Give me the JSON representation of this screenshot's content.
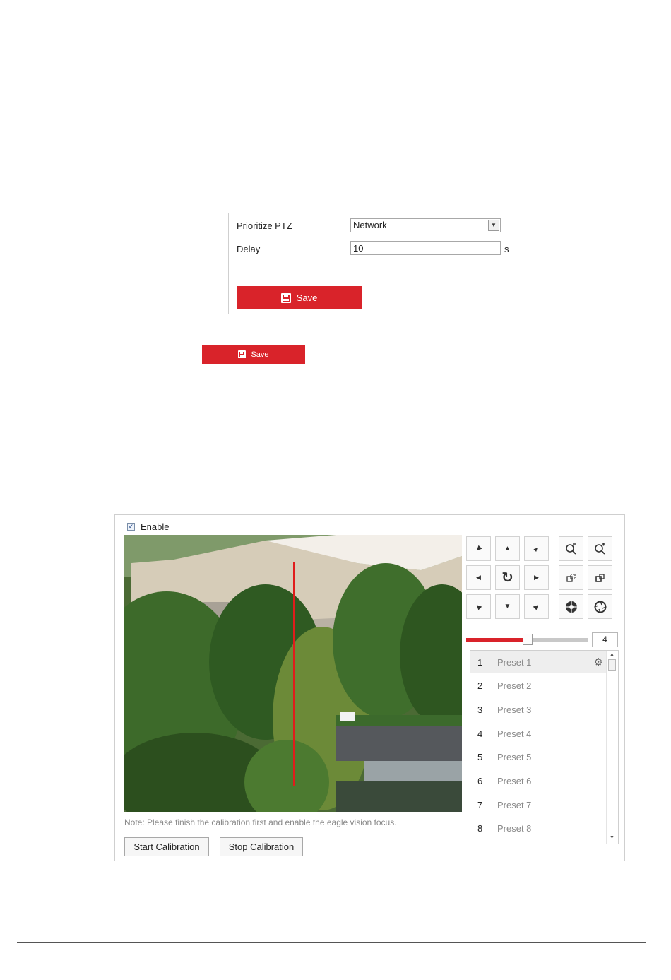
{
  "ptz_form": {
    "prioritize_label": "Prioritize PTZ",
    "prioritize_value": "Network",
    "delay_label": "Delay",
    "delay_value": "10",
    "delay_unit": "s",
    "save_label": "Save"
  },
  "standalone_save_label": "Save",
  "eagle": {
    "enable_label": "Enable",
    "enable_checked": true,
    "zoom_value": "4",
    "zoom_fraction": 0.5,
    "note": "Note: Please finish the calibration first and enable the eagle vision focus.",
    "start_label": "Start Calibration",
    "stop_label": "Stop Calibration",
    "presets": [
      {
        "num": "1",
        "name": "Preset 1"
      },
      {
        "num": "2",
        "name": "Preset 2"
      },
      {
        "num": "3",
        "name": "Preset 3"
      },
      {
        "num": "4",
        "name": "Preset 4"
      },
      {
        "num": "5",
        "name": "Preset 5"
      },
      {
        "num": "6",
        "name": "Preset 6"
      },
      {
        "num": "7",
        "name": "Preset 7"
      },
      {
        "num": "8",
        "name": "Preset 8"
      }
    ]
  },
  "colors": {
    "accent": "#d9232a",
    "border": "#cfcfcf",
    "muted_text": "#8a8a8a"
  }
}
